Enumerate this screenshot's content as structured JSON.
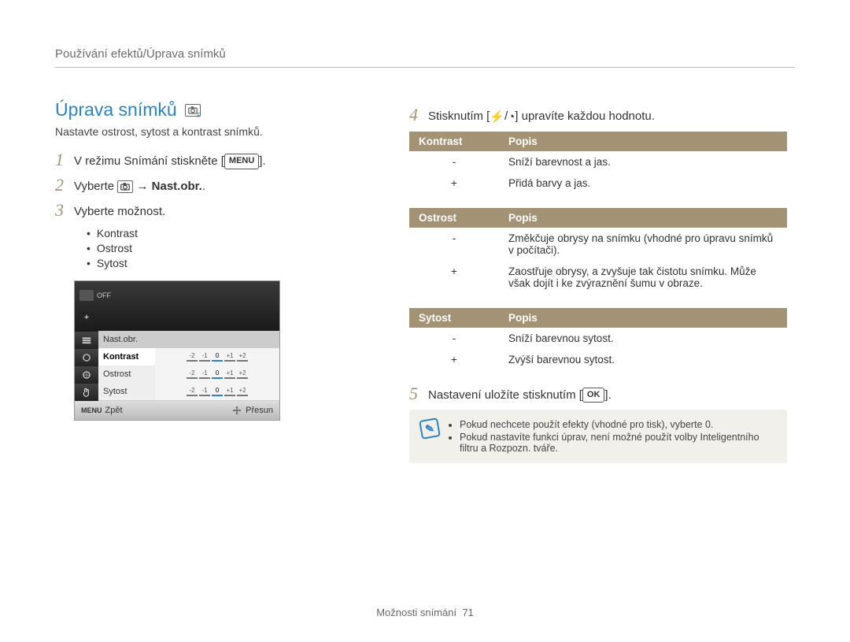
{
  "breadcrumb": "Používání efektů/Úprava snímků",
  "heading": "Úprava snímků",
  "subtitle": "Nastavte ostrost, sytost a kontrast snímků.",
  "steps_left": [
    {
      "num": "1",
      "text_pre": "V režimu Snímání stiskněte [",
      "button": "MENU",
      "text_post": "]."
    },
    {
      "num": "2",
      "text_pre": "Vyberte ",
      "icon": "camera",
      "arrow": " → ",
      "bold": "Nast.obr.",
      "text_post": "."
    },
    {
      "num": "3",
      "text_pre": "Vyberte možnost."
    }
  ],
  "option_bullets": [
    "Kontrast",
    "Ostrost",
    "Sytost"
  ],
  "camera_ui": {
    "top_off": "OFF",
    "header_label": "Nast.obr.",
    "rows": [
      {
        "label": "Kontrast",
        "selected": true
      },
      {
        "label": "Ostrost"
      },
      {
        "label": "Sytost"
      }
    ],
    "ticks": [
      "-2",
      "-1",
      "0",
      "+1",
      "+2"
    ],
    "bottom_left_icon": "MENU",
    "bottom_left": "Zpět",
    "bottom_right": "Přesun"
  },
  "steps_right": [
    {
      "num": "4",
      "text_pre": "Stisknutím [",
      "icon1": "flash",
      "sep": "/",
      "icon2": "timer",
      "text_post": "] upravíte každou hodnotu."
    },
    {
      "num": "5",
      "text_pre": "Nastavení uložíte stisknutím [",
      "button": "OK",
      "text_post": "]."
    }
  ],
  "tables": [
    {
      "h1": "Kontrast",
      "h2": "Popis",
      "rows": [
        {
          "k": "-",
          "v": "Sníží barevnost a jas."
        },
        {
          "k": "+",
          "v": "Přidá barvy a jas."
        }
      ]
    },
    {
      "h1": "Ostrost",
      "h2": "Popis",
      "rows": [
        {
          "k": "-",
          "v": "Změkčuje obrysy na snímku (vhodné pro úpravu snímků v počítači)."
        },
        {
          "k": "+",
          "v": "Zaostřuje obrysy, a zvyšuje tak čistotu snímku. Může však dojít i ke zvýraznění šumu v obraze."
        }
      ]
    },
    {
      "h1": "Sytost",
      "h2": "Popis",
      "rows": [
        {
          "k": "-",
          "v": "Sníží barevnou sytost."
        },
        {
          "k": "+",
          "v": "Zvýší barevnou sytost."
        }
      ]
    }
  ],
  "notes": [
    "Pokud nechcete použít efekty (vhodné pro tisk), vyberte 0.",
    "Pokud nastavíte funkci úprav, není možné použít volby Inteligentního filtru a Rozpozn. tváře."
  ],
  "footer_label": "Možnosti snímání",
  "footer_page": "71"
}
